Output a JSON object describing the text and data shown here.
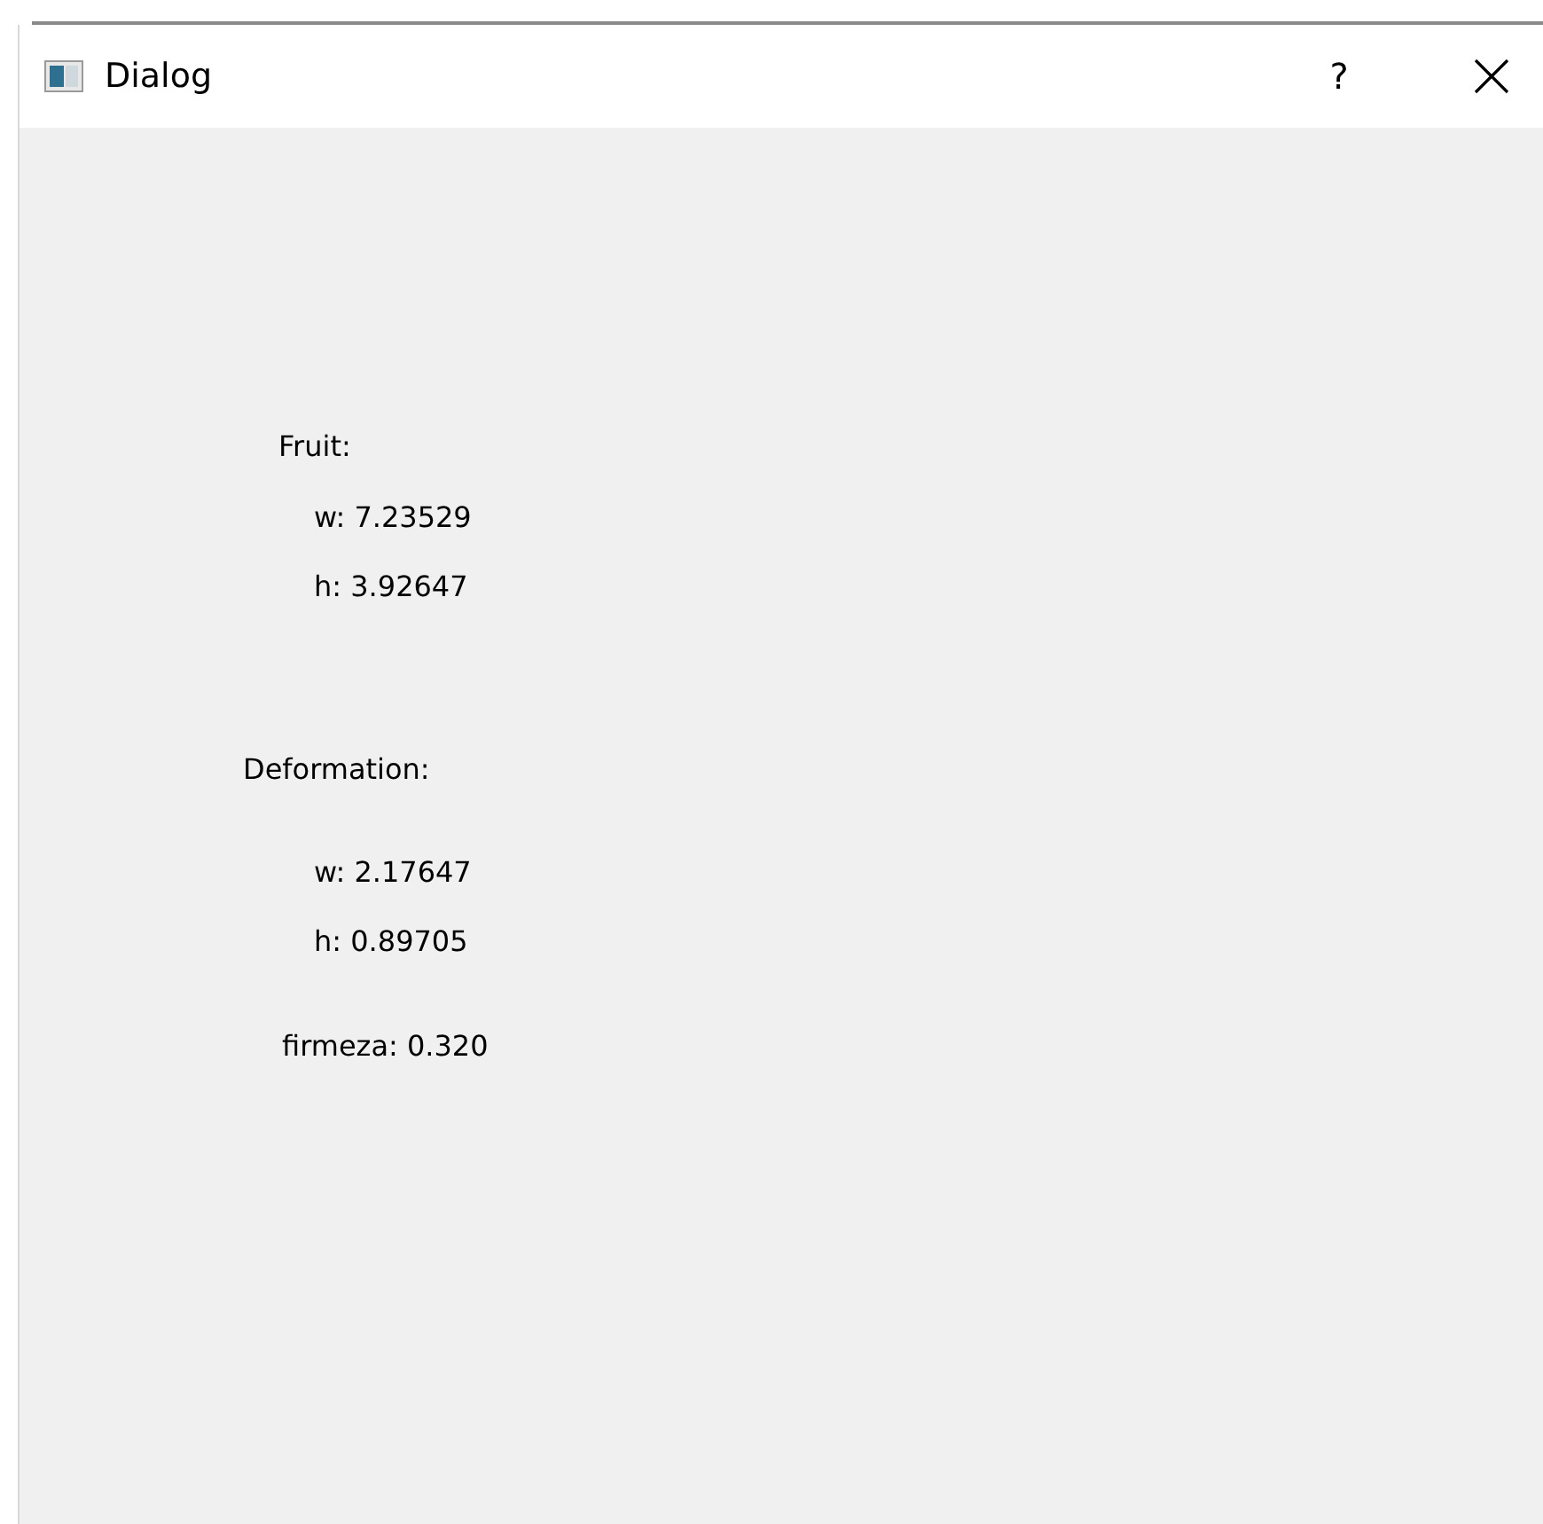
{
  "window": {
    "title": "Dialog",
    "help": "?"
  },
  "fruit": {
    "label": "Fruit:",
    "w": "w: 7.23529",
    "h": "h: 3.92647"
  },
  "deformation": {
    "label": "Deformation:",
    "w": "w: 2.17647",
    "h": "h: 0.89705"
  },
  "firmeza": "firmeza: 0.320"
}
